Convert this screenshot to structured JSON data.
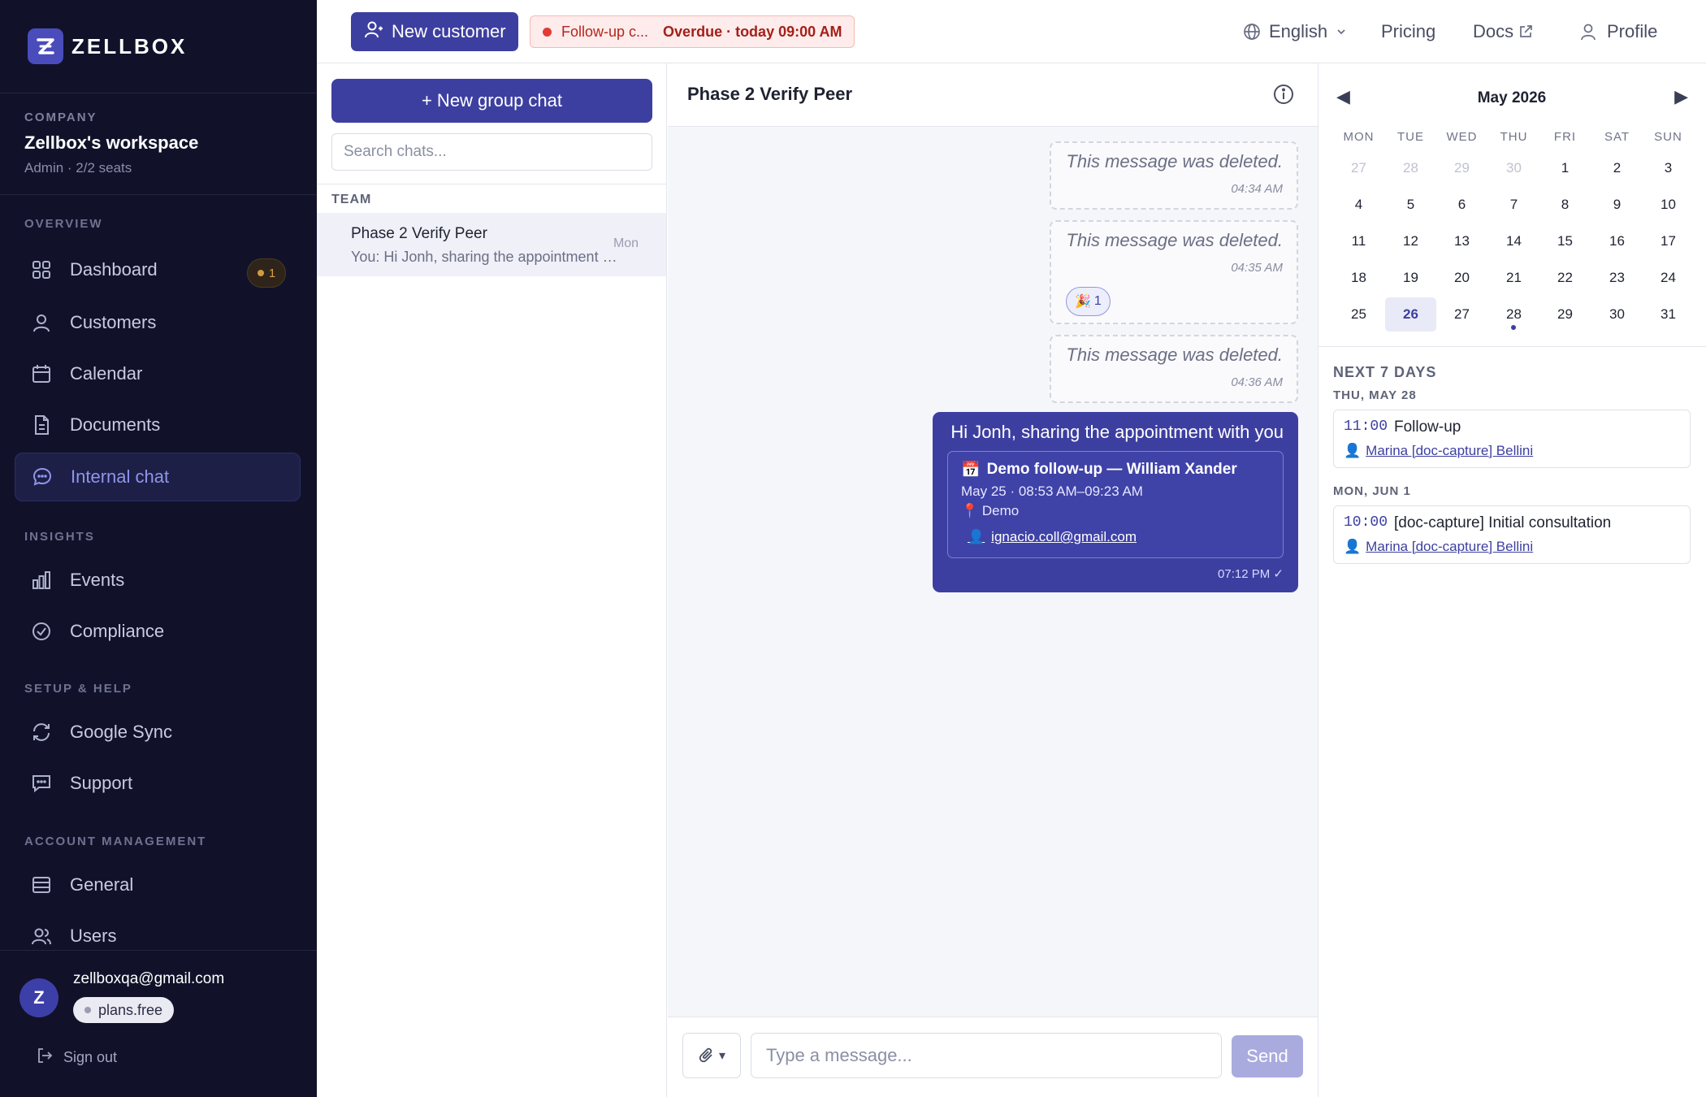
{
  "sidebar": {
    "brand": "ZELLBOX",
    "company_label": "COMPANY",
    "company_name": "Zellbox's workspace",
    "company_meta": "Admin · 2/2 seats",
    "sections": {
      "overview": "OVERVIEW",
      "insights": "INSIGHTS",
      "setup": "SETUP & HELP",
      "account": "ACCOUNT MANAGEMENT"
    },
    "items": {
      "dashboard": "Dashboard",
      "dashboard_badge": "1",
      "customers": "Customers",
      "calendar": "Calendar",
      "documents": "Documents",
      "internal_chat": "Internal chat",
      "events": "Events",
      "compliance": "Compliance",
      "google_sync": "Google Sync",
      "support": "Support",
      "general": "General",
      "users": "Users"
    },
    "user": {
      "avatar_letter": "Z",
      "email": "zellboxqa@gmail.com",
      "plan": "plans.free"
    },
    "signout": "Sign out"
  },
  "topbar": {
    "new_customer": "New customer",
    "overdue_label": "Follow-up c...",
    "overdue_time": "Overdue · today 09:00 AM",
    "language": "English",
    "pricing": "Pricing",
    "docs": "Docs",
    "profile": "Profile"
  },
  "chatlist": {
    "new_group": "+ New group chat",
    "search_placeholder": "Search chats...",
    "team_label": "TEAM",
    "chats": [
      {
        "name": "Phase 2 Verify Peer",
        "day": "Mon",
        "preview_prefix": "You:",
        "preview": "Hi Jonh, sharing the appointment with you"
      }
    ]
  },
  "conversation": {
    "title": "Phase 2 Verify Peer",
    "deleted_messages": [
      {
        "text": "This message was deleted.",
        "time": "04:34 AM"
      },
      {
        "text": "This message was deleted.",
        "time": "04:35 AM",
        "reaction": "🎉",
        "reaction_count": "1"
      },
      {
        "text": "This message was deleted.",
        "time": "04:36 AM"
      }
    ],
    "outgoing": {
      "text": "Hi Jonh, sharing the appointment with you",
      "appointment": {
        "icon": "📅",
        "title": "Demo follow-up — William Xander",
        "time": "May 25 · 08:53 AM–09:23 AM",
        "location_icon": "📍",
        "location": "Demo",
        "person_icon": "👤",
        "email": "ignacio.coll@gmail.com"
      },
      "stamp": "07:12 PM ✓"
    },
    "composer": {
      "attach": "▾",
      "placeholder": "Type a message...",
      "send": "Send"
    }
  },
  "calendar": {
    "prev": "◀",
    "next": "▶",
    "month": "May 2026",
    "weekdays": [
      "MON",
      "TUE",
      "WED",
      "THU",
      "FRI",
      "SAT",
      "SUN"
    ],
    "weeks": [
      [
        "27",
        "28",
        "29",
        "30",
        "1",
        "2",
        "3"
      ],
      [
        "4",
        "5",
        "6",
        "7",
        "8",
        "9",
        "10"
      ],
      [
        "11",
        "12",
        "13",
        "14",
        "15",
        "16",
        "17"
      ],
      [
        "18",
        "19",
        "20",
        "21",
        "22",
        "23",
        "24"
      ],
      [
        "25",
        "26",
        "27",
        "28",
        "29",
        "30",
        "31"
      ]
    ],
    "muted_first_row_count": 4,
    "today": "26",
    "event_day": "28",
    "next7_label": "NEXT 7 DAYS",
    "groups": [
      {
        "day_label": "THU, MAY 28",
        "events": [
          {
            "time": "11:00",
            "title": "Follow-up",
            "person": "Marina [doc-capture] Bellini"
          }
        ]
      },
      {
        "day_label": "MON, JUN 1",
        "events": [
          {
            "time": "10:00",
            "title": "[doc-capture] Initial consultation",
            "person": "Marina [doc-capture] Bellini"
          }
        ]
      }
    ]
  },
  "colors": {
    "sidebar_bg": "#11122a",
    "accent": "#3d3fa0",
    "overdue_red": "#e23b36"
  }
}
